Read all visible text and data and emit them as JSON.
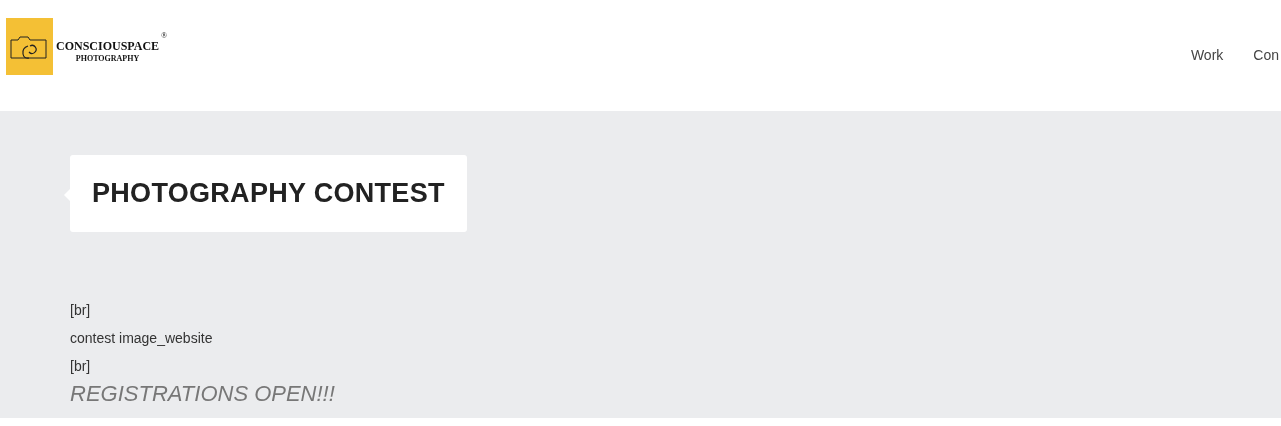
{
  "header": {
    "logo": {
      "name": "CONSCIOUSPACE",
      "mark": "®",
      "tagline": "PHOTOGRAPHY"
    },
    "nav": [
      {
        "label": "Work"
      },
      {
        "label": "Con"
      }
    ]
  },
  "page_title": "PHOTOGRAPHY CONTEST",
  "content": [
    {
      "kind": "text",
      "text": "[br]"
    },
    {
      "kind": "text",
      "text": "contest image_website"
    },
    {
      "kind": "text",
      "text": "[br]"
    },
    {
      "kind": "headline",
      "text": "REGISTRATIONS OPEN!!!"
    }
  ]
}
